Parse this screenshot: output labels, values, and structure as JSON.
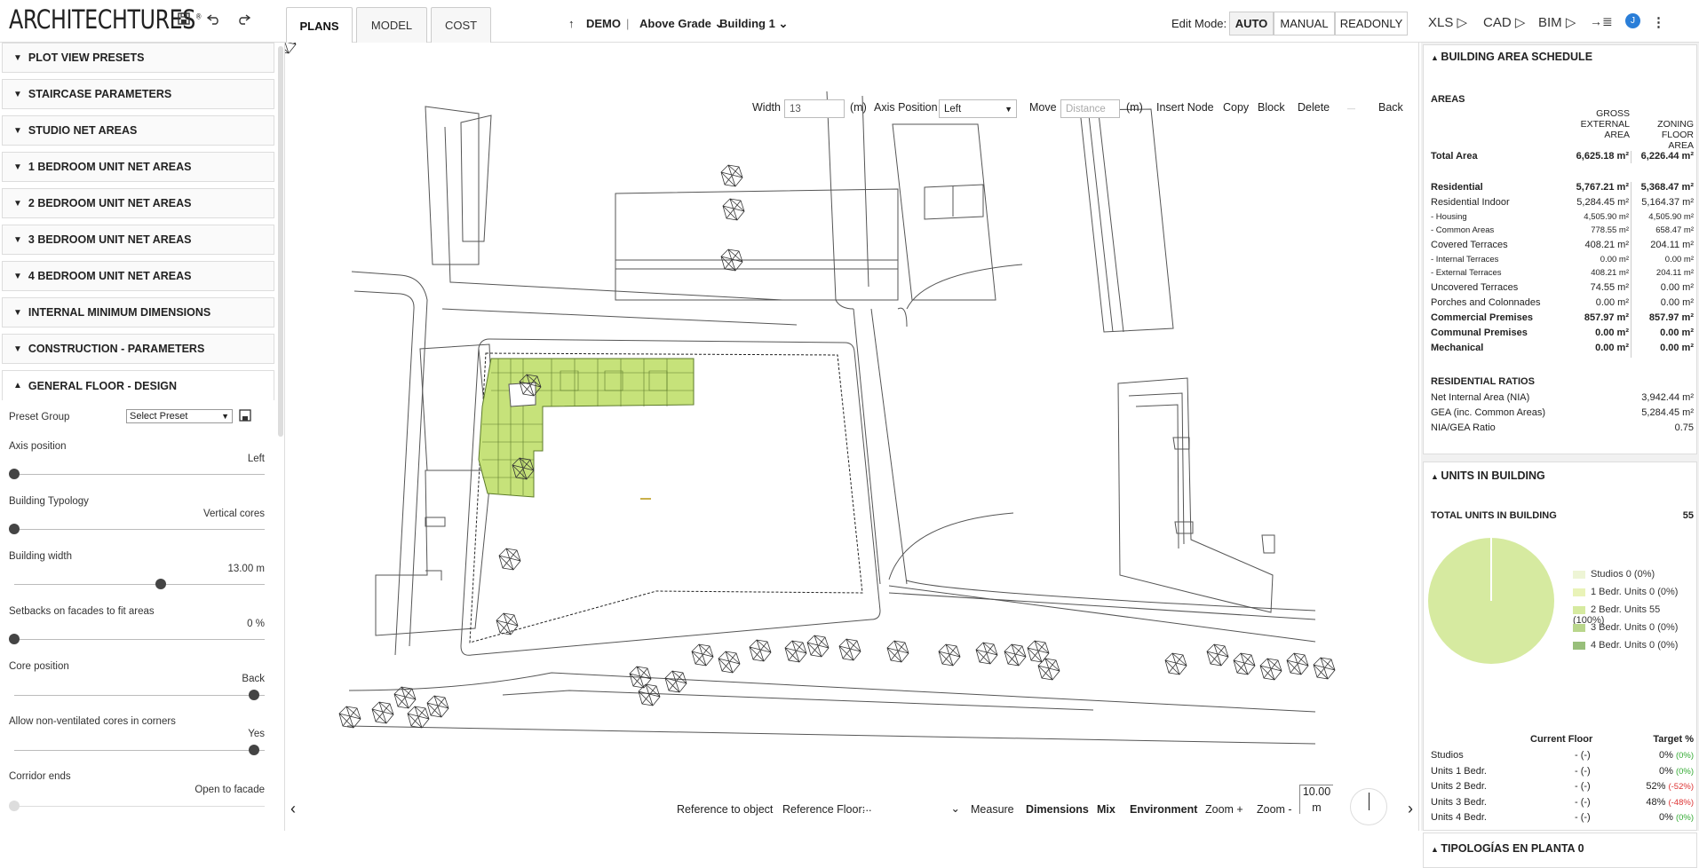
{
  "app": {
    "logo": "ARCHITECHTURES",
    "logo_mark": "®"
  },
  "tabs": [
    {
      "label": "PLANS",
      "active": true
    },
    {
      "label": "MODEL"
    },
    {
      "label": "COST"
    }
  ],
  "breadcrumb": {
    "project": "DEMO",
    "level": "Above Grade",
    "building": "Building 1",
    "separator": "|"
  },
  "edit_mode": {
    "label": "Edit Mode:",
    "options": [
      "AUTO",
      "MANUAL",
      "READONLY"
    ],
    "selected": "AUTO"
  },
  "exports": [
    "XLS",
    "CAD",
    "BIM"
  ],
  "user": {
    "avatar": "J"
  },
  "left_panel": {
    "sections": [
      "PLOT VIEW PRESETS",
      "STAIRCASE PARAMETERS",
      "STUDIO NET AREAS",
      "1 BEDROOM UNIT NET AREAS",
      "2 BEDROOM UNIT NET AREAS",
      "3 BEDROOM UNIT NET AREAS",
      "4 BEDROOM UNIT NET AREAS",
      "INTERNAL MINIMUM DIMENSIONS",
      "CONSTRUCTION - PARAMETERS"
    ],
    "open_section": "GENERAL FLOOR - DESIGN",
    "preset_group": {
      "label": "Preset Group",
      "value": "Select Preset"
    },
    "params": [
      {
        "label": "Axis position",
        "value": "Left",
        "level": 0
      },
      {
        "label": "Building Typology",
        "value": "Vertical cores",
        "level": 0
      },
      {
        "label": "Building width",
        "value": "13.00 m",
        "level": 0.61
      },
      {
        "label": "Setbacks on facades to fit areas",
        "value": "0 %",
        "level": 0
      },
      {
        "label": "Core position",
        "value": "Back",
        "level": 1
      },
      {
        "label": "Allow non-ventilated cores in corners",
        "value": "Yes",
        "level": 1
      },
      {
        "label": "Corridor ends",
        "value": "Open to facade",
        "level": 0
      }
    ]
  },
  "canvas_toolbar": {
    "width_label": "Width",
    "width_value": "13",
    "unit": "(m)",
    "axis_label": "Axis Position",
    "axis_value": "Left",
    "move_label": "Move",
    "move_placeholder": "Distance",
    "move_unit": "(m)",
    "actions": [
      "Insert Node",
      "Copy",
      "Block",
      "Delete"
    ],
    "dash": "—",
    "back": "Back"
  },
  "bottom_toolbar": {
    "reference_object": "Reference to object",
    "reference_floor_label": "Reference Floor:",
    "reference_floor_value": "...",
    "measure": "Measure",
    "dimensions": "Dimensions",
    "mix": "Mix",
    "environment": "Environment",
    "zoom_in": "Zoom +",
    "zoom_out": "Zoom -",
    "scale_value": "10.00",
    "scale_unit": "m"
  },
  "schedule": {
    "title": "BUILDING AREA SCHEDULE",
    "areas_heading": "AREAS",
    "col_a": "GROSS EXTERNAL AREA",
    "col_b": "ZONING FLOOR AREA",
    "rows": [
      {
        "name": "Total Area",
        "a": "6,625.18 m²",
        "b": "6,226.44 m²",
        "bold": true,
        "size": "n"
      },
      {
        "name": "Residential",
        "a": "5,767.21 m²",
        "b": "5,368.47 m²",
        "bold": true,
        "size": "n"
      },
      {
        "name": "Residential Indoor",
        "a": "5,284.45 m²",
        "b": "5,164.37 m²",
        "bold": false,
        "size": "n"
      },
      {
        "name": "- Housing",
        "a": "4,505.90 m²",
        "b": "4,505.90 m²",
        "bold": false,
        "size": "s"
      },
      {
        "name": "- Common Areas",
        "a": "778.55 m²",
        "b": "658.47 m²",
        "bold": false,
        "size": "s"
      },
      {
        "name": "Covered Terraces",
        "a": "408.21 m²",
        "b": "204.11 m²",
        "bold": false,
        "size": "n"
      },
      {
        "name": "- Internal Terraces",
        "a": "0.00 m²",
        "b": "0.00 m²",
        "bold": false,
        "size": "s"
      },
      {
        "name": "- External Terraces",
        "a": "408.21 m²",
        "b": "204.11 m²",
        "bold": false,
        "size": "s"
      },
      {
        "name": "Uncovered Terraces",
        "a": "74.55 m²",
        "b": "0.00 m²",
        "bold": false,
        "size": "n"
      },
      {
        "name": "Porches and Colonnades",
        "a": "0.00 m²",
        "b": "0.00 m²",
        "bold": false,
        "size": "n"
      },
      {
        "name": "Commercial Premises",
        "a": "857.97 m²",
        "b": "857.97 m²",
        "bold": true,
        "size": "n"
      },
      {
        "name": "Communal Premises",
        "a": "0.00 m²",
        "b": "0.00 m²",
        "bold": true,
        "size": "n"
      },
      {
        "name": "Mechanical",
        "a": "0.00 m²",
        "b": "0.00 m²",
        "bold": true,
        "size": "n"
      }
    ],
    "ratios_heading": "RESIDENTIAL RATIOS",
    "ratios": [
      {
        "name": "Net Internal Area (NIA)",
        "value": "3,942.44 m²"
      },
      {
        "name": "GEA (inc. Common Areas)",
        "value": "5,284.45 m²"
      },
      {
        "name": "NIA/GEA Ratio",
        "value": "0.75"
      }
    ]
  },
  "units": {
    "title": "UNITS IN BUILDING",
    "total_label": "TOTAL UNITS IN BUILDING",
    "total_value": "55",
    "legend": [
      {
        "label": "Studios 0 (0%)",
        "color": "#eef5d6"
      },
      {
        "label": "1 Bedr. Units 0 (0%)",
        "color": "#e9f3b8"
      },
      {
        "label": "2 Bedr. Units 55 (100%)",
        "color": "#d6eaa0"
      },
      {
        "label": "3 Bedr. Units 0 (0%)",
        "color": "#b9d68c"
      },
      {
        "label": "4 Bedr. Units 0 (0%)",
        "color": "#98bf7a"
      }
    ],
    "pie_share": 1.0,
    "col_current": "Current Floor",
    "col_target": "Target %",
    "rows": [
      {
        "name": "Studios",
        "current": "- (-)",
        "target": "0%",
        "delta": "(0%)",
        "delta_color": "g"
      },
      {
        "name": "Units 1 Bedr.",
        "current": "- (-)",
        "target": "0%",
        "delta": "(0%)",
        "delta_color": "g"
      },
      {
        "name": "Units 2 Bedr.",
        "current": "- (-)",
        "target": "52%",
        "delta": "(-52%)",
        "delta_color": "r"
      },
      {
        "name": "Units 3 Bedr.",
        "current": "- (-)",
        "target": "48%",
        "delta": "(-48%)",
        "delta_color": "r"
      },
      {
        "name": "Units 4 Bedr.",
        "current": "- (-)",
        "target": "0%",
        "delta": "(0%)",
        "delta_color": "g"
      }
    ]
  },
  "tipologias": {
    "title": "TIPOLOGÍAS EN PLANTA 0"
  },
  "colors": {
    "building_fill": "#c6e27a",
    "accent": "#2a7ed8"
  }
}
